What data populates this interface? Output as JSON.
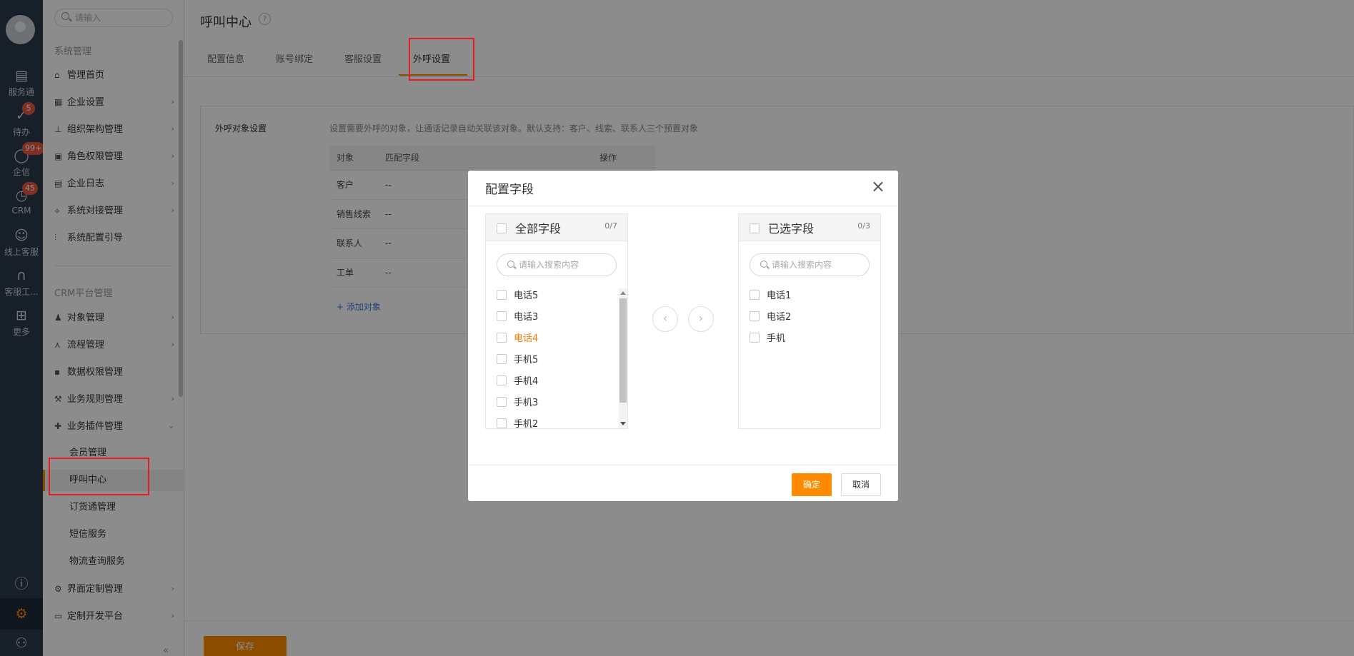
{
  "rail": {
    "items": [
      {
        "label": "服务通",
        "icon": "clipboard-icon",
        "badge": ""
      },
      {
        "label": "待办",
        "icon": "todo-check-icon",
        "badge": "5"
      },
      {
        "label": "企信",
        "icon": "chat-icon",
        "badge": "99+"
      },
      {
        "label": "CRM",
        "icon": "crm-clock-icon",
        "badge": "45"
      },
      {
        "label": "线上客服",
        "icon": "online-service-icon",
        "badge": ""
      },
      {
        "label": "客服工...",
        "icon": "headset-icon",
        "badge": ""
      },
      {
        "label": "更多",
        "icon": "grid-icon",
        "badge": ""
      }
    ],
    "bottom": [
      "help-icon",
      "settings-gear-icon",
      "user-manage-icon"
    ]
  },
  "sidebar": {
    "search_placeholder": "请输入",
    "section1": "系统管理",
    "section2": "CRM平台管理",
    "items1": [
      {
        "label": "管理首页",
        "chev": ""
      },
      {
        "label": "企业设置",
        "chev": "›"
      },
      {
        "label": "组织架构管理",
        "chev": "›"
      },
      {
        "label": "角色权限管理",
        "chev": "›"
      },
      {
        "label": "企业日志",
        "chev": "›"
      },
      {
        "label": "系统对接管理",
        "chev": "›"
      },
      {
        "label": "系统配置引导",
        "chev": ""
      }
    ],
    "items2": [
      {
        "label": "对象管理",
        "chev": "›"
      },
      {
        "label": "流程管理",
        "chev": "›"
      },
      {
        "label": "数据权限管理",
        "chev": ""
      },
      {
        "label": "业务规则管理",
        "chev": "›"
      },
      {
        "label": "业务插件管理",
        "chev": "⌄"
      }
    ],
    "subitems": [
      "会员管理",
      "呼叫中心",
      "订货通管理",
      "短信服务",
      "物流查询服务"
    ],
    "items3": [
      {
        "label": "界面定制管理",
        "chev": "›"
      },
      {
        "label": "定制开发平台",
        "chev": "›"
      }
    ],
    "collapse": "«"
  },
  "main": {
    "title": "呼叫中心",
    "help": "?",
    "tabs": [
      "配置信息",
      "账号绑定",
      "客服设置",
      "外呼设置"
    ],
    "active_tab": "外呼设置",
    "panel_label": "外呼对象设置",
    "panel_desc": "设置需要外呼的对象，让通话记录自动关联该对象。默认支持：客户、线索、联系人三个预置对象",
    "table": {
      "headers": [
        "对象",
        "匹配字段",
        "操作"
      ],
      "rows": [
        [
          "客户",
          "--",
          ""
        ],
        [
          "销售线索",
          "--",
          ""
        ],
        [
          "联系人",
          "--",
          ""
        ],
        [
          "工单",
          "--",
          ""
        ]
      ]
    },
    "add_object": "+ 添加对象",
    "save": "保存"
  },
  "modal": {
    "title": "配置字段",
    "close": "×",
    "left": {
      "title": "全部字段",
      "count": "0/7",
      "search_placeholder": "请输入搜索内容",
      "items": [
        "电话5",
        "电话3",
        "电话4",
        "手机5",
        "手机4",
        "手机3",
        "手机2"
      ]
    },
    "right": {
      "title": "已选字段",
      "count": "0/3",
      "search_placeholder": "请输入搜索内容",
      "items": [
        "电话1",
        "电话2",
        "手机"
      ]
    },
    "ok": "确定",
    "cancel": "取消"
  },
  "colors": {
    "accent": "#ff8a00",
    "highlight": "#ff7a00",
    "annotation": "#e51c23"
  }
}
